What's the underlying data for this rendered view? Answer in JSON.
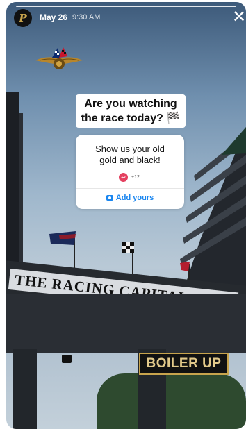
{
  "story": {
    "date": "May 26",
    "time": "9:30 AM",
    "avatar_letter": "P",
    "close_glyph": "✕"
  },
  "scene": {
    "banner_text": "THE RACING CAPITAL OF THE WORLD",
    "boiler_sticker": "BOILER UP"
  },
  "question": {
    "line1": "Are you watching",
    "line2": "the race today? 🏁"
  },
  "add_yours": {
    "prompt_line1": "Show us your old",
    "prompt_line2": "gold and black!",
    "participants": "+12",
    "button_label": "Add yours"
  },
  "colors": {
    "accent_blue": "#1a86f0",
    "purdue_gold": "#c8a44d",
    "response_pink": "#e4405f"
  }
}
